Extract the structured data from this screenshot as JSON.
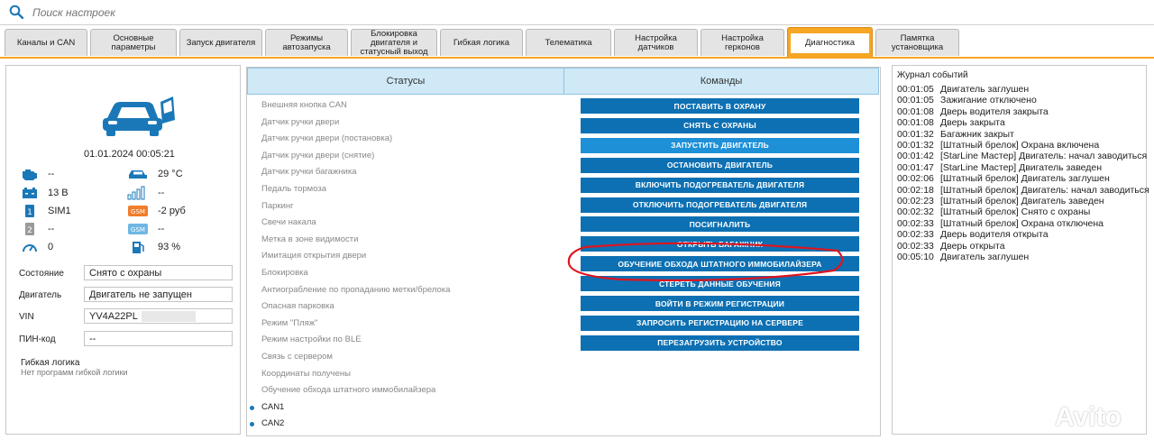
{
  "search": {
    "placeholder": "Поиск настроек"
  },
  "tabs": [
    {
      "label": "Каналы и CAN"
    },
    {
      "label": "Основные параметры"
    },
    {
      "label": "Запуск двигателя"
    },
    {
      "label": "Режимы автозапуска"
    },
    {
      "label": "Блокировка двигателя и статусный выход"
    },
    {
      "label": "Гибкая логика"
    },
    {
      "label": "Телематика"
    },
    {
      "label": "Настройка датчиков"
    },
    {
      "label": "Настройка герконов"
    },
    {
      "label": "Диагностика"
    },
    {
      "label": "Памятка установщика"
    }
  ],
  "active_tab": "Диагностика",
  "device": {
    "datetime": "01.01.2024 00:05:21",
    "engine_temp": "--",
    "cabin_temp": "29 °C",
    "voltage": "13 В",
    "gsm_signal": "--",
    "sim1": "SIM1",
    "balance": "-2 руб",
    "sim2": "--",
    "gsm2": "--",
    "speed": "0",
    "fuel": "93 %"
  },
  "fields": {
    "state_label": "Состояние",
    "state_value": "Снято с охраны",
    "engine_label": "Двигатель",
    "engine_value": "Двигатель не запущен",
    "vin_label": "VIN",
    "vin_value": "YV4A22PL",
    "pin_label": "ПИН-код",
    "pin_value": "--"
  },
  "flex_logic": {
    "title": "Гибкая логика",
    "subtitle": "Нет программ гибкой логики"
  },
  "statuses_header": "Статусы",
  "commands_header": "Команды",
  "statuses": [
    "Внешняя кнопка CAN",
    "Датчик ручки двери",
    "Датчик ручки двери (постановка)",
    "Датчик ручки двери (снятие)",
    "Датчик ручки багажника",
    "Педаль тормоза",
    "Паркинг",
    "Свечи накала",
    "Метка в зоне видимости",
    "Имитация открытия двери",
    "Блокировка",
    "Антиограбление по пропаданию метки/брелока",
    "Опасная парковка",
    "Режим \"Пляж\"",
    "Режим настройки по BLE",
    "Связь с сервером",
    "Координаты получены",
    "Обучение обхода штатного иммобилайзера",
    "CAN1",
    "CAN2"
  ],
  "commands": [
    "ПОСТАВИТЬ В ОХРАНУ",
    "СНЯТЬ С ОХРАНЫ",
    "ЗАПУСТИТЬ ДВИГАТЕЛЬ",
    "ОСТАНОВИТЬ ДВИГАТЕЛЬ",
    "ВКЛЮЧИТЬ ПОДОГРЕВАТЕЛЬ ДВИГАТЕЛЯ",
    "ОТКЛЮЧИТЬ ПОДОГРЕВАТЕЛЬ ДВИГАТЕЛЯ",
    "ПОСИГНАЛИТЬ",
    "ОТКРЫТЬ БАГАЖНИК",
    "ОБУЧЕНИЕ ОБХОДА ШТАТНОГО ИММОБИЛАЙЗЕРА",
    "СТЕРЕТЬ ДАННЫЕ ОБУЧЕНИЯ",
    "ВОЙТИ В РЕЖИМ РЕГИСТРАЦИИ",
    "ЗАПРОСИТЬ РЕГИСТРАЦИЮ НА СЕРВЕРЕ",
    "ПЕРЕЗАГРУЗИТЬ УСТРОЙСТВО"
  ],
  "log": {
    "title": "Журнал событий",
    "entries": [
      {
        "time": "00:01:05",
        "text": "Двигатель заглушен"
      },
      {
        "time": "00:01:05",
        "text": "Зажигание отключено"
      },
      {
        "time": "00:01:08",
        "text": "Дверь водителя закрыта"
      },
      {
        "time": "00:01:08",
        "text": "Дверь закрыта"
      },
      {
        "time": "00:01:32",
        "text": "Багажник закрыт"
      },
      {
        "time": "00:01:32",
        "text": "[Штатный брелок] Охрана включена"
      },
      {
        "time": "00:01:42",
        "text": "[StarLine Мастер] Двигатель: начал заводиться"
      },
      {
        "time": "00:01:47",
        "text": "[StarLine Мастер] Двигатель заведен"
      },
      {
        "time": "00:02:06",
        "text": "[Штатный брелок] Двигатель заглушен"
      },
      {
        "time": "00:02:18",
        "text": "[Штатный брелок] Двигатель: начал заводиться"
      },
      {
        "time": "00:02:23",
        "text": "[Штатный брелок] Двигатель заведен"
      },
      {
        "time": "00:02:32",
        "text": "[Штатный брелок] Снято с охраны"
      },
      {
        "time": "00:02:33",
        "text": "[Штатный брелок] Охрана отключена"
      },
      {
        "time": "00:02:33",
        "text": "Дверь водителя открыта"
      },
      {
        "time": "00:02:33",
        "text": "Дверь открыта"
      },
      {
        "time": "00:05:10",
        "text": "Двигатель заглушен"
      }
    ]
  },
  "watermark": "Avito",
  "colors": {
    "accent_tab": "#f6a623",
    "command_button": "#0d70b3",
    "command_button_highlight": "#1e90d8",
    "header_bg": "#cfe9f7",
    "icon_blue": "#1b78b8",
    "icon_orange": "#f07d2b",
    "annotation_red": "#e0141e"
  }
}
